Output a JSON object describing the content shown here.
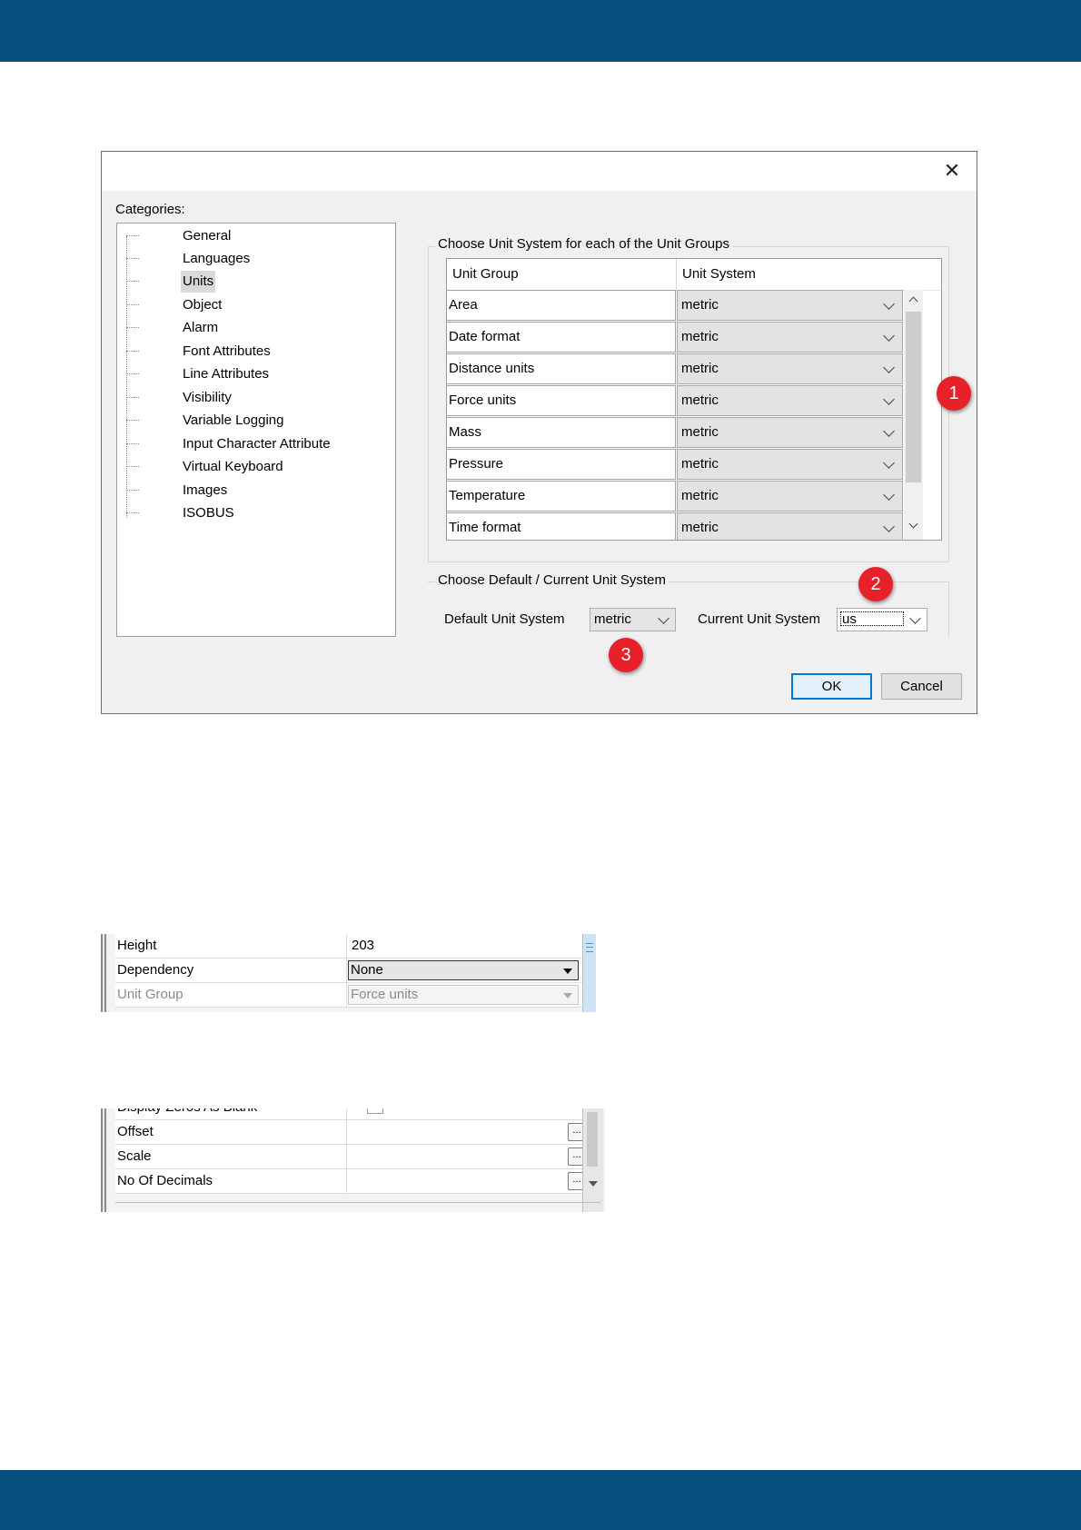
{
  "dialog": {
    "close_label": "✕",
    "categories_label": "Categories:",
    "categories": [
      "General",
      "Languages",
      "Units",
      "Object",
      "Alarm",
      "Font Attributes",
      "Line Attributes",
      "Visibility",
      "Variable Logging",
      "Input Character Attribute",
      "Virtual Keyboard",
      "Images",
      "ISOBUS"
    ],
    "selected_category": "Units",
    "unit_groups_title": "Choose Unit System for each of the Unit Groups",
    "grid_headers": {
      "unit_group": "Unit Group",
      "unit_system": "Unit System"
    },
    "unit_rows": [
      {
        "group": "Area",
        "system": "metric"
      },
      {
        "group": "Date format",
        "system": "metric"
      },
      {
        "group": "Distance units",
        "system": "metric"
      },
      {
        "group": "Force units",
        "system": "metric"
      },
      {
        "group": "Mass",
        "system": "metric"
      },
      {
        "group": "Pressure",
        "system": "metric"
      },
      {
        "group": "Temperature",
        "system": "metric"
      },
      {
        "group": "Time format",
        "system": "metric"
      }
    ],
    "default_current_title": "Choose Default / Current Unit System",
    "default_label": "Default Unit System",
    "default_value": "metric",
    "current_label": "Current Unit System",
    "current_value": "us",
    "ok_label": "OK",
    "cancel_label": "Cancel"
  },
  "badges": [
    "1",
    "2",
    "3"
  ],
  "badge_color": "#e8202a",
  "band_color": "#064f7c",
  "panel1": {
    "rows": [
      {
        "name": "Height",
        "value": "203"
      },
      {
        "name": "Dependency",
        "value": "None"
      },
      {
        "name": "Unit Group",
        "value": "Force units"
      }
    ]
  },
  "panel2": {
    "partial_row": "Display Zeros As Blank",
    "rows": [
      {
        "name": "Offset",
        "button": "..."
      },
      {
        "name": "Scale",
        "button": "..."
      },
      {
        "name": "No Of Decimals",
        "button": "..."
      }
    ]
  }
}
